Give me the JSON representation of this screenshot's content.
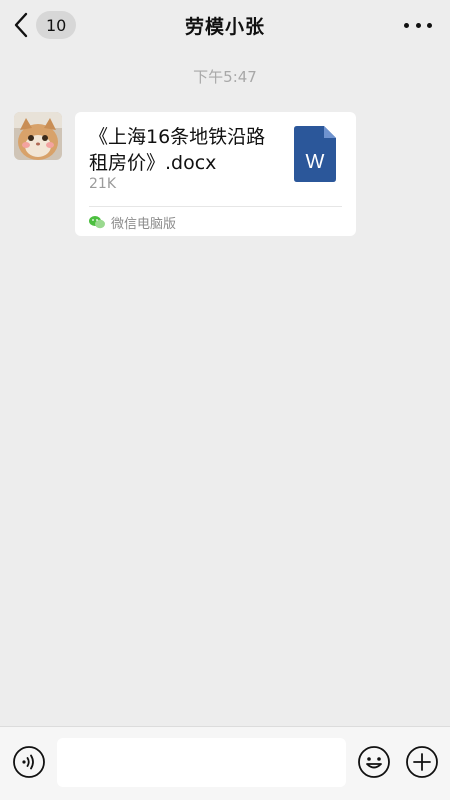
{
  "header": {
    "back_count": "10",
    "title": "劳模小张",
    "back_icon": "chevron-left-icon",
    "more_icon": "more-horizontal-icon"
  },
  "conversation": {
    "timestamp": "下午5:47",
    "messages": [
      {
        "type": "file",
        "file_name": "《上海16条地铁沿路租房价》.docx",
        "file_size": "21K",
        "file_icon": "word-document-icon",
        "source": "微信电脑版",
        "source_icon": "wechat-icon"
      }
    ]
  },
  "input_bar": {
    "value": "",
    "voice_icon": "voice-icon",
    "emoji_icon": "emoji-icon",
    "plus_icon": "plus-icon"
  },
  "colors": {
    "background": "#ededed",
    "bubble": "#ffffff",
    "word_blue": "#2b579a",
    "muted_text": "#a8a8a8"
  }
}
